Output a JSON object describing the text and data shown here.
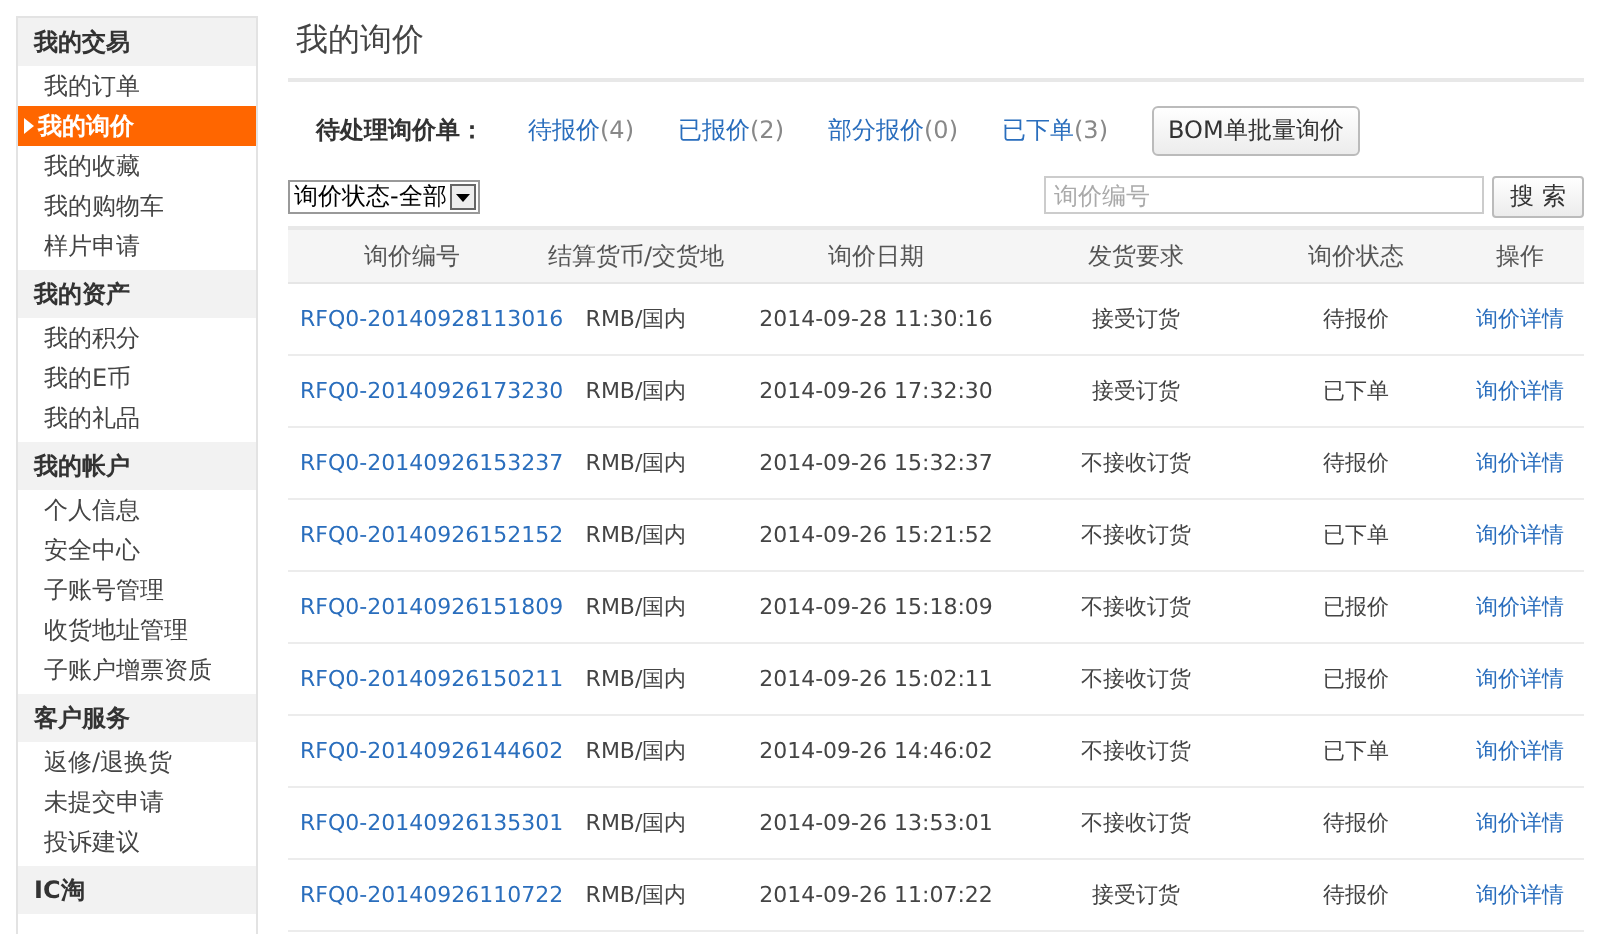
{
  "sidebar": {
    "sections": [
      {
        "title": "我的交易",
        "items": [
          {
            "label": "我的订单",
            "selected": false
          },
          {
            "label": "我的询价",
            "selected": true
          },
          {
            "label": "我的收藏",
            "selected": false
          },
          {
            "label": "我的购物车",
            "selected": false
          },
          {
            "label": "样片申请",
            "selected": false
          }
        ]
      },
      {
        "title": "我的资产",
        "items": [
          {
            "label": "我的积分",
            "selected": false
          },
          {
            "label": "我的E币",
            "selected": false
          },
          {
            "label": "我的礼品",
            "selected": false
          }
        ]
      },
      {
        "title": "我的帐户",
        "items": [
          {
            "label": "个人信息",
            "selected": false
          },
          {
            "label": "安全中心",
            "selected": false
          },
          {
            "label": "子账号管理",
            "selected": false
          },
          {
            "label": "收货地址管理",
            "selected": false
          },
          {
            "label": "子账户增票资质",
            "selected": false
          }
        ]
      },
      {
        "title": "客户服务",
        "items": [
          {
            "label": "返修/退换货",
            "selected": false
          },
          {
            "label": "未提交申请",
            "selected": false
          },
          {
            "label": "投诉建议",
            "selected": false
          }
        ]
      },
      {
        "title": "IC淘"
      }
    ]
  },
  "page_title": "我的询价",
  "pending": {
    "label": "待处理询价单：",
    "links": [
      {
        "label": "待报价",
        "count": "(4)"
      },
      {
        "label": "已报价",
        "count": "(2)"
      },
      {
        "label": "部分报价",
        "count": "(0)"
      },
      {
        "label": "已下单",
        "count": "(3)"
      }
    ],
    "bom_button": "BOM单批量询价"
  },
  "status_filter": {
    "value": "询价状态-全部"
  },
  "search": {
    "placeholder": "询价编号",
    "button": "搜 索"
  },
  "table": {
    "columns": [
      "询价编号",
      "结算货币/交货地",
      "询价日期",
      "发货要求",
      "询价状态",
      "操作"
    ],
    "rows": [
      [
        "RFQ0-20140928113016",
        "RMB/国内",
        "2014-09-28 11:30:16",
        "接受订货",
        "待报价",
        "询价详情"
      ],
      [
        "RFQ0-20140926173230",
        "RMB/国内",
        "2014-09-26 17:32:30",
        "接受订货",
        "已下单",
        "询价详情"
      ],
      [
        "RFQ0-20140926153237",
        "RMB/国内",
        "2014-09-26 15:32:37",
        "不接收订货",
        "待报价",
        "询价详情"
      ],
      [
        "RFQ0-20140926152152",
        "RMB/国内",
        "2014-09-26 15:21:52",
        "不接收订货",
        "已下单",
        "询价详情"
      ],
      [
        "RFQ0-20140926151809",
        "RMB/国内",
        "2014-09-26 15:18:09",
        "不接收订货",
        "已报价",
        "询价详情"
      ],
      [
        "RFQ0-20140926150211",
        "RMB/国内",
        "2014-09-26 15:02:11",
        "不接收订货",
        "已报价",
        "询价详情"
      ],
      [
        "RFQ0-20140926144602",
        "RMB/国内",
        "2014-09-26 14:46:02",
        "不接收订货",
        "已下单",
        "询价详情"
      ],
      [
        "RFQ0-20140926135301",
        "RMB/国内",
        "2014-09-26 13:53:01",
        "不接收订货",
        "待报价",
        "询价详情"
      ],
      [
        "RFQ0-20140926110722",
        "RMB/国内",
        "2014-09-26 11:07:22",
        "接受订货",
        "待报价",
        "询价详情"
      ]
    ]
  }
}
